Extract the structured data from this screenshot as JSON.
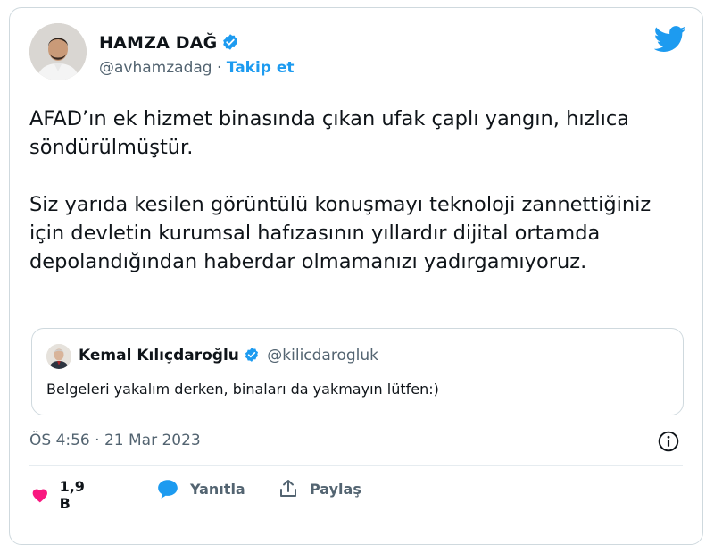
{
  "author": {
    "name": "HAMZA DAĞ",
    "handle": "@avhamzadag",
    "separator": "·",
    "follow_label": "Takip et"
  },
  "tweet": {
    "paragraphs": [
      "AFAD’ın ek hizmet binasında çıkan ufak çaplı yangın, hızlıca söndürülmüştür.",
      "Siz yarıda kesilen görüntülü konuşmayı teknoloji zannettiğiniz için devletin kurumsal hafızasının yıllardır dijital ortamda depolandığından haberdar olmamanızı yadırgamıyoruz."
    ],
    "timestamp": "ÖS 4:56 · 21 Mar 2023"
  },
  "quoted_tweet": {
    "name": "Kemal Kılıçdaroğlu",
    "handle": "@kilicdarogluk",
    "text": "Belgeleri yakalım derken, binaları da yakmayın lütfen:)"
  },
  "actions": {
    "like_count": "1,9 B",
    "reply_label": "Yanıtla",
    "share_label": "Paylaş"
  },
  "colors": {
    "accent": "#1d9bf0",
    "like": "#f91880",
    "muted": "#536471",
    "text": "#0f1419",
    "border": "#cfd9de"
  },
  "icons": {
    "platform": "twitter-bird-icon",
    "verified": "verified-badge-icon",
    "info": "info-icon",
    "like": "heart-icon",
    "reply": "speech-bubble-icon",
    "share": "share-icon"
  }
}
